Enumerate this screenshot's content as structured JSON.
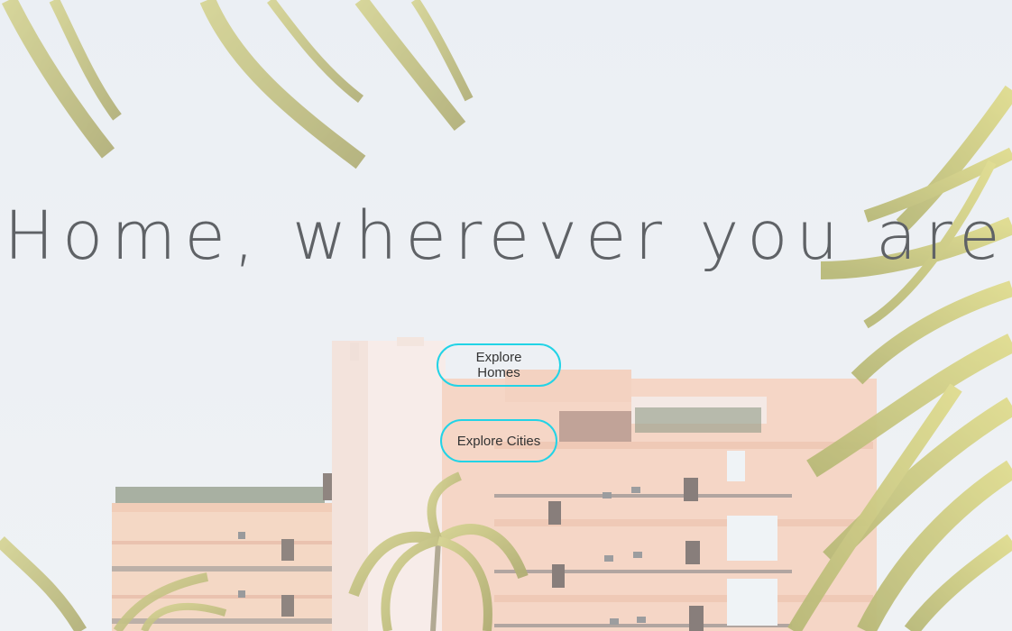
{
  "hero": {
    "headline": "Home, wherever you are",
    "buttons": {
      "explore_homes": "Explore Homes",
      "explore_cities": "Explore Cities"
    }
  },
  "colors": {
    "sky": "#eaeef2",
    "headline_text": "#5f6266",
    "button_border": "#22d3e6",
    "button_text": "#333333",
    "building": "#f6c9b1",
    "building_light": "#fbe7dc",
    "palm_frond": "#b7b347"
  }
}
